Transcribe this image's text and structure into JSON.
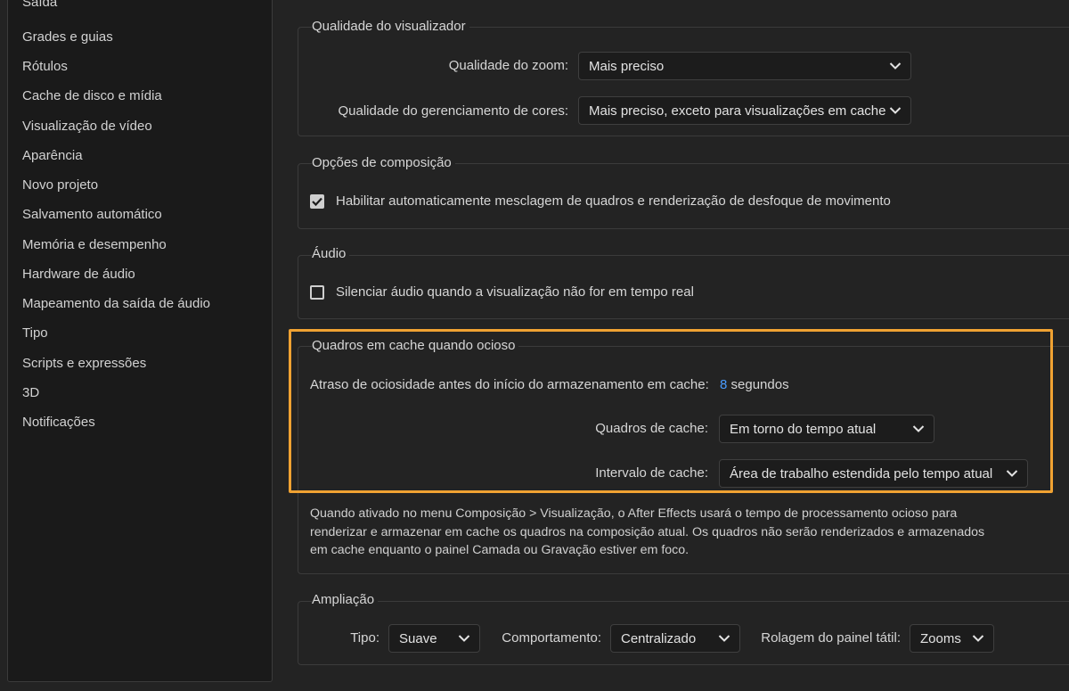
{
  "sidebar": {
    "items": [
      {
        "label": "Saída"
      },
      {
        "label": "Grades e guias"
      },
      {
        "label": "Rótulos"
      },
      {
        "label": "Cache de disco e mídia"
      },
      {
        "label": "Visualização de vídeo"
      },
      {
        "label": "Aparência"
      },
      {
        "label": "Novo projeto"
      },
      {
        "label": "Salvamento automático"
      },
      {
        "label": "Memória e desempenho"
      },
      {
        "label": "Hardware de áudio"
      },
      {
        "label": "Mapeamento da saída de áudio"
      },
      {
        "label": "Tipo"
      },
      {
        "label": "Scripts e expressões"
      },
      {
        "label": "3D"
      },
      {
        "label": "Notificações"
      }
    ]
  },
  "viewer_quality": {
    "title": "Qualidade do visualizador",
    "zoom_label": "Qualidade do zoom:",
    "zoom_value": "Mais preciso",
    "color_label": "Qualidade do gerenciamento de cores:",
    "color_value": "Mais preciso, exceto para visualizações em cache"
  },
  "composition_options": {
    "title": "Opções de composição",
    "checkbox_label": "Habilitar automaticamente mesclagem de quadros e renderização de desfoque de movimento",
    "checked": true
  },
  "audio": {
    "title": "Áudio",
    "checkbox_label": "Silenciar áudio quando a visualização não for em tempo real",
    "checked": false
  },
  "cache_idle": {
    "title": "Quadros em cache quando ocioso",
    "delay_label": "Atraso de ociosidade antes do início do armazenamento em cache:",
    "delay_value": "8",
    "delay_unit": "segundos",
    "frames_label": "Quadros de cache:",
    "frames_value": "Em torno do tempo atual",
    "range_label": "Intervalo de cache:",
    "range_value": "Área de trabalho estendida pelo tempo atual",
    "description": "Quando ativado no menu Composição > Visualização, o After Effects usará o tempo de processamento ocioso para renderizar e armazenar em cache os quadros na composição atual. Os quadros não serão renderizados e armazenados em cache enquanto o painel Camada ou Gravação estiver em foco.",
    "highlight_color": "#f0a232"
  },
  "zoom": {
    "title": "Ampliação",
    "type_label": "Tipo:",
    "type_value": "Suave",
    "behavior_label": "Comportamento:",
    "behavior_value": "Centralizado",
    "touchpad_label": "Rolagem do painel tátil:",
    "touchpad_value": "Zooms"
  }
}
